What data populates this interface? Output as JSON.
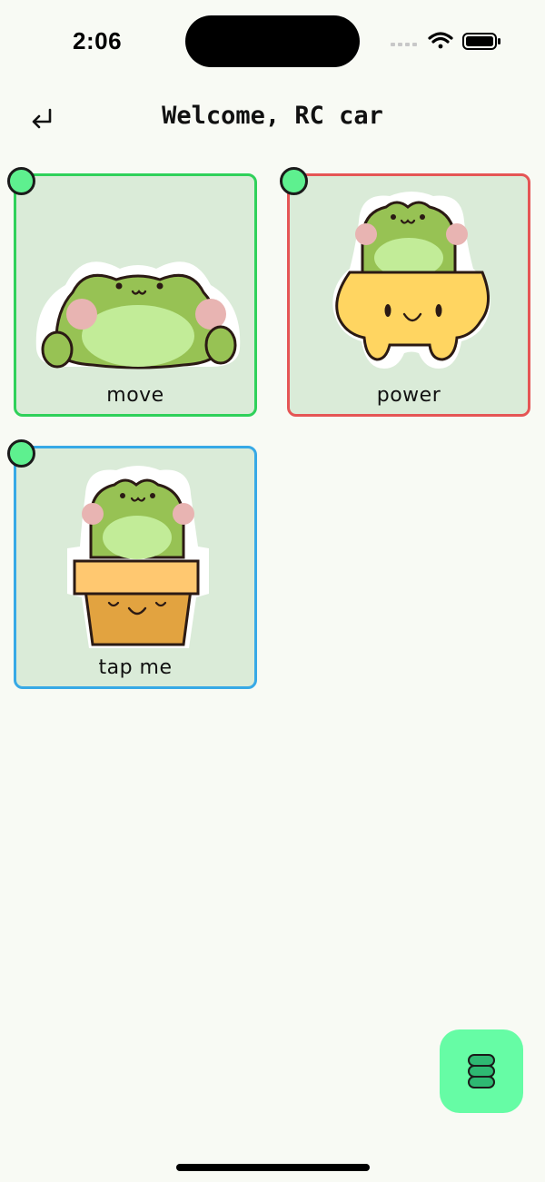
{
  "status_bar": {
    "time": "2:06"
  },
  "header": {
    "title": "Welcome, RC car",
    "back_icon": "return-arrow-icon"
  },
  "cards": [
    {
      "label": "move",
      "border_color": "#2fd15a",
      "image": "frog-sticker"
    },
    {
      "label": "power",
      "border_color": "#e55555",
      "image": "frog-in-yellow-pot"
    },
    {
      "label": "tap me",
      "border_color": "#37a9e6",
      "image": "frog-in-orange-pot"
    }
  ],
  "fab": {
    "icon": "stack-icon",
    "color": "#66fca5"
  },
  "colors": {
    "background": "#f8faf4",
    "card_fill": "#daebd8",
    "indicator_dot": "#5ef08f"
  }
}
